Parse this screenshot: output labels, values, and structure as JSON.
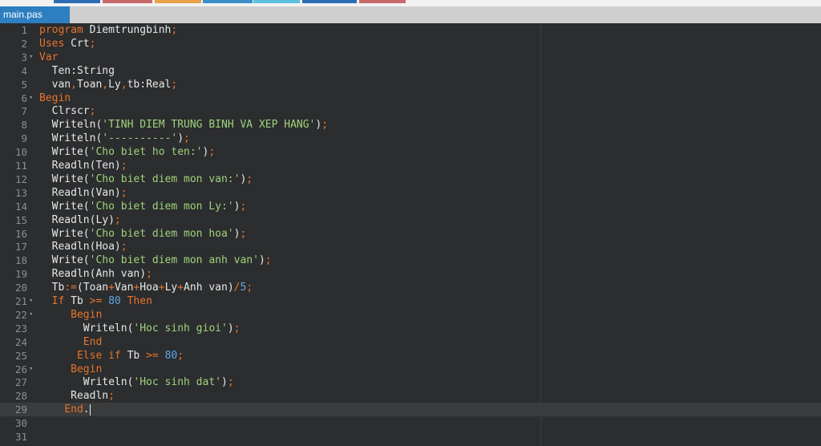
{
  "tab": {
    "label": "main.pas"
  },
  "top_strip_colors": [
    "#2e6db4",
    "#c96a6a",
    "#e9a14a",
    "#3a8fc9",
    "#5bc0de"
  ],
  "lines": [
    {
      "n": "1",
      "fold": false,
      "active": false,
      "tokens": [
        [
          "kw",
          "program"
        ],
        [
          "pl",
          " Diemtrungbinh"
        ],
        [
          "op",
          ";"
        ]
      ]
    },
    {
      "n": "2",
      "fold": false,
      "active": false,
      "tokens": [
        [
          "kw",
          "Uses"
        ],
        [
          "pl",
          " Crt"
        ],
        [
          "op",
          ";"
        ]
      ]
    },
    {
      "n": "3",
      "fold": true,
      "active": false,
      "tokens": [
        [
          "kw",
          "Var"
        ]
      ]
    },
    {
      "n": "4",
      "fold": false,
      "active": false,
      "tokens": [
        [
          "pl",
          "  Ten:String"
        ]
      ]
    },
    {
      "n": "5",
      "fold": false,
      "active": false,
      "tokens": [
        [
          "pl",
          "  van"
        ],
        [
          "op",
          ","
        ],
        [
          "pl",
          "Toan"
        ],
        [
          "op",
          ","
        ],
        [
          "pl",
          "Ly"
        ],
        [
          "op",
          ","
        ],
        [
          "pl",
          "tb:Real"
        ],
        [
          "op",
          ";"
        ]
      ]
    },
    {
      "n": "6",
      "fold": true,
      "active": false,
      "tokens": [
        [
          "kw",
          "Begin"
        ]
      ]
    },
    {
      "n": "7",
      "fold": false,
      "active": false,
      "tokens": [
        [
          "pl",
          "  Clrscr"
        ],
        [
          "op",
          ";"
        ]
      ]
    },
    {
      "n": "8",
      "fold": false,
      "active": false,
      "tokens": [
        [
          "pl",
          "  Writeln("
        ],
        [
          "str",
          "'TINH DIEM TRUNG BINH VA XEP HANG'"
        ],
        [
          "pl",
          ")"
        ],
        [
          "op",
          ";"
        ]
      ]
    },
    {
      "n": "9",
      "fold": false,
      "active": false,
      "tokens": [
        [
          "pl",
          "  Writeln("
        ],
        [
          "str",
          "'----------'"
        ],
        [
          "pl",
          ")"
        ],
        [
          "op",
          ";"
        ]
      ]
    },
    {
      "n": "10",
      "fold": false,
      "active": false,
      "tokens": [
        [
          "pl",
          "  Write("
        ],
        [
          "str",
          "'Cho biet ho ten:'"
        ],
        [
          "pl",
          ")"
        ],
        [
          "op",
          ";"
        ]
      ]
    },
    {
      "n": "11",
      "fold": false,
      "active": false,
      "tokens": [
        [
          "pl",
          "  Readln(Ten)"
        ],
        [
          "op",
          ";"
        ]
      ]
    },
    {
      "n": "12",
      "fold": false,
      "active": false,
      "tokens": [
        [
          "pl",
          "  Write("
        ],
        [
          "str",
          "'Cho biet diem mon van:'"
        ],
        [
          "pl",
          ")"
        ],
        [
          "op",
          ";"
        ]
      ]
    },
    {
      "n": "13",
      "fold": false,
      "active": false,
      "tokens": [
        [
          "pl",
          "  Readln(Van)"
        ],
        [
          "op",
          ";"
        ]
      ]
    },
    {
      "n": "14",
      "fold": false,
      "active": false,
      "tokens": [
        [
          "pl",
          "  Write("
        ],
        [
          "str",
          "'Cho biet diem mon Ly:'"
        ],
        [
          "pl",
          ")"
        ],
        [
          "op",
          ";"
        ]
      ]
    },
    {
      "n": "15",
      "fold": false,
      "active": false,
      "tokens": [
        [
          "pl",
          "  Readln(Ly)"
        ],
        [
          "op",
          ";"
        ]
      ]
    },
    {
      "n": "16",
      "fold": false,
      "active": false,
      "tokens": [
        [
          "pl",
          "  Write("
        ],
        [
          "str",
          "'Cho biet diem mon hoa'"
        ],
        [
          "pl",
          ")"
        ],
        [
          "op",
          ";"
        ]
      ]
    },
    {
      "n": "17",
      "fold": false,
      "active": false,
      "tokens": [
        [
          "pl",
          "  Readln(Hoa)"
        ],
        [
          "op",
          ";"
        ]
      ]
    },
    {
      "n": "18",
      "fold": false,
      "active": false,
      "tokens": [
        [
          "pl",
          "  Write("
        ],
        [
          "str",
          "'Cho biet diem mon anh van'"
        ],
        [
          "pl",
          ")"
        ],
        [
          "op",
          ";"
        ]
      ]
    },
    {
      "n": "19",
      "fold": false,
      "active": false,
      "tokens": [
        [
          "pl",
          "  Readln(Anh van)"
        ],
        [
          "op",
          ";"
        ]
      ]
    },
    {
      "n": "20",
      "fold": false,
      "active": false,
      "tokens": [
        [
          "pl",
          "  Tb"
        ],
        [
          "op",
          ":="
        ],
        [
          "pl",
          "(Toan"
        ],
        [
          "op",
          "+"
        ],
        [
          "pl",
          "Van"
        ],
        [
          "op",
          "+"
        ],
        [
          "pl",
          "Hoa"
        ],
        [
          "op",
          "+"
        ],
        [
          "pl",
          "Ly"
        ],
        [
          "op",
          "+"
        ],
        [
          "pl",
          "Anh van)"
        ],
        [
          "op",
          "/"
        ],
        [
          "num",
          "5"
        ],
        [
          "op",
          ";"
        ]
      ]
    },
    {
      "n": "21",
      "fold": true,
      "active": false,
      "tokens": [
        [
          "pl",
          "  "
        ],
        [
          "kw",
          "If"
        ],
        [
          "pl",
          " Tb "
        ],
        [
          "op",
          ">="
        ],
        [
          "pl",
          " "
        ],
        [
          "num",
          "80"
        ],
        [
          "pl",
          " "
        ],
        [
          "kw",
          "Then"
        ]
      ]
    },
    {
      "n": "22",
      "fold": true,
      "active": false,
      "tokens": [
        [
          "pl",
          "     "
        ],
        [
          "kw",
          "Begin"
        ]
      ]
    },
    {
      "n": "23",
      "fold": false,
      "active": false,
      "tokens": [
        [
          "pl",
          "       Writeln("
        ],
        [
          "str",
          "'Hoc sinh gioi'"
        ],
        [
          "pl",
          ")"
        ],
        [
          "op",
          ";"
        ]
      ]
    },
    {
      "n": "24",
      "fold": false,
      "active": false,
      "tokens": [
        [
          "pl",
          "       "
        ],
        [
          "kw",
          "End"
        ]
      ]
    },
    {
      "n": "25",
      "fold": false,
      "active": false,
      "tokens": [
        [
          "pl",
          "      "
        ],
        [
          "kw",
          "Else if"
        ],
        [
          "pl",
          " Tb "
        ],
        [
          "op",
          ">="
        ],
        [
          "pl",
          " "
        ],
        [
          "num",
          "80"
        ],
        [
          "op",
          ";"
        ]
      ]
    },
    {
      "n": "26",
      "fold": true,
      "active": false,
      "tokens": [
        [
          "pl",
          "     "
        ],
        [
          "kw",
          "Begin"
        ]
      ]
    },
    {
      "n": "27",
      "fold": false,
      "active": false,
      "tokens": [
        [
          "pl",
          "       Writeln("
        ],
        [
          "str",
          "'Hoc sinh dat'"
        ],
        [
          "pl",
          ")"
        ],
        [
          "op",
          ";"
        ]
      ]
    },
    {
      "n": "28",
      "fold": false,
      "active": false,
      "tokens": [
        [
          "pl",
          "     Readln"
        ],
        [
          "op",
          ";"
        ]
      ]
    },
    {
      "n": "29",
      "fold": false,
      "active": true,
      "tokens": [
        [
          "pl",
          "    "
        ],
        [
          "kw",
          "End"
        ],
        [
          "pl",
          "."
        ]
      ],
      "cursor": true
    },
    {
      "n": "30",
      "fold": false,
      "active": false,
      "tokens": []
    },
    {
      "n": "31",
      "fold": false,
      "active": false,
      "tokens": []
    }
  ]
}
